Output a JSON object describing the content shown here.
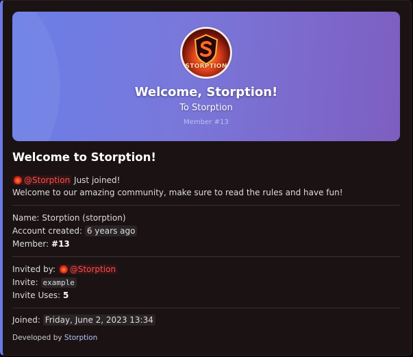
{
  "banner": {
    "avatar_text": "STORPTION",
    "title": "Welcome, Storption!",
    "subtitle": "To Storption",
    "member_text": "Member #13"
  },
  "embed": {
    "title": "Welcome to Storption!",
    "mention": "@Storption",
    "just_joined": "Just joined!",
    "welcome_message": "Welcome to our amazing community, make sure to read the rules and have fun!",
    "name_label": "Name:",
    "name_value": "Storption (storption)",
    "account_created_label": "Account created:",
    "account_created_value": "6 years ago",
    "member_label": "Member:",
    "member_value": "#13",
    "invited_by_label": "Invited by:",
    "invited_by_value": "@Storption",
    "invite_label": "Invite:",
    "invite_value": "example",
    "invite_uses_label": "Invite Uses:",
    "invite_uses_value": "5",
    "joined_label": "Joined:",
    "joined_value": "Friday, June 2, 2023 13:34",
    "footer_prefix": "Developed by",
    "footer_link": "Storption"
  },
  "colors": {
    "accent_bar": "#6a79e6",
    "mention": "#ff4d4d",
    "embed_bg": "#1b1213"
  },
  "icons": [
    "server-avatar-icon",
    "user-avatar-icon"
  ]
}
